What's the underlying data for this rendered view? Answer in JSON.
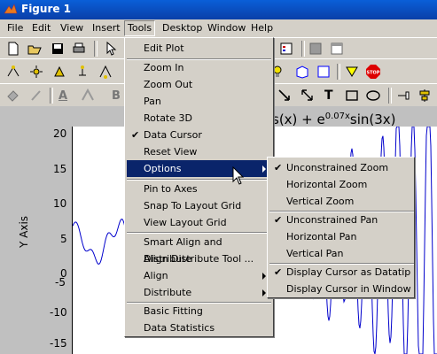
{
  "window": {
    "title": "Figure 1"
  },
  "menubar": {
    "items": [
      "File",
      "Edit",
      "View",
      "Insert",
      "Tools",
      "Desktop",
      "Window",
      "Help"
    ]
  },
  "tools_menu": {
    "items": [
      {
        "label": "Edit Plot"
      },
      {
        "label": "Zoom In"
      },
      {
        "label": "Zoom Out"
      },
      {
        "label": "Pan"
      },
      {
        "label": "Rotate 3D"
      },
      {
        "label": "Data Cursor",
        "checked": true
      },
      {
        "label": "Reset View"
      },
      {
        "label": "Options",
        "submenu": true,
        "highlighted": true
      },
      {
        "label": "Pin to Axes"
      },
      {
        "label": "Snap To Layout Grid"
      },
      {
        "label": "View Layout Grid"
      },
      {
        "label": "Smart Align and Distribute"
      },
      {
        "label": "Align Distribute Tool ..."
      },
      {
        "label": "Align",
        "submenu": true
      },
      {
        "label": "Distribute",
        "submenu": true
      },
      {
        "label": "Basic Fitting"
      },
      {
        "label": "Data Statistics"
      }
    ]
  },
  "options_menu": {
    "items": [
      {
        "label": "Unconstrained Zoom",
        "checked": true
      },
      {
        "label": "Horizontal Zoom"
      },
      {
        "label": "Vertical Zoom"
      },
      {
        "label": "Unconstrained Pan",
        "checked": true
      },
      {
        "label": "Horizontal Pan"
      },
      {
        "label": "Vertical Pan"
      },
      {
        "label": "Display Cursor as Datatip",
        "checked": true
      },
      {
        "label": "Display Cursor in Window"
      }
    ]
  },
  "toolbar": {
    "stop_label": "STOP",
    "text_tool": "T",
    "bold_tool": "B",
    "underline_tool": "A"
  },
  "plot": {
    "title_visible": "s(x) + e",
    "title_exponent": "0.07x",
    "title_tail": "sin(3x)",
    "ylabel": "Y Axis",
    "yticks": [
      "20",
      "15",
      "10",
      "5",
      "0",
      "-5",
      "-10",
      "-15"
    ],
    "line_color": "#0000cc"
  },
  "colors": {
    "highlight": "#0a246a",
    "titlebar": "#0a3fa8"
  }
}
